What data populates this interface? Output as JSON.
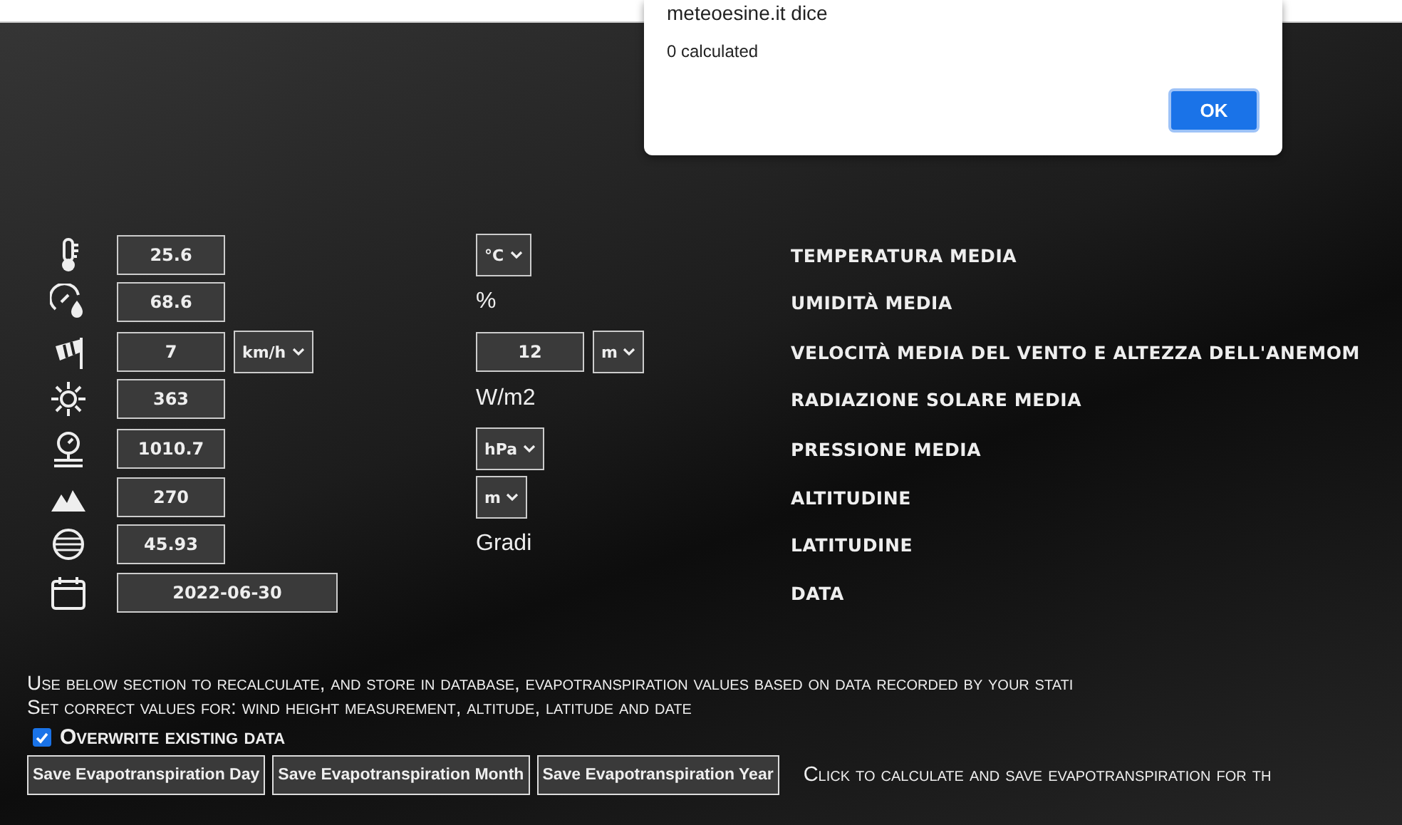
{
  "dialog": {
    "title": "meteoesine.it dice",
    "message": "0 calculated",
    "button": "OK"
  },
  "rows": [
    {
      "value": "25.6",
      "right": [
        {
          "kind": "select",
          "text": "°C"
        }
      ],
      "label": "TEMPERATURA MEDIA"
    },
    {
      "value": "68.6",
      "right": [
        {
          "kind": "text",
          "text": "%"
        }
      ],
      "label": "UMIDITÀ MEDIA"
    },
    {
      "value": "7",
      "value_unit": "km/h",
      "right": [
        {
          "kind": "field",
          "text": "12"
        },
        {
          "kind": "select",
          "text": "m"
        }
      ],
      "label": "VELOCITÀ MEDIA DEL VENTO E ALTEZZA DELL'ANEMOM"
    },
    {
      "value": "363",
      "right": [
        {
          "kind": "text",
          "text": "W/m2"
        }
      ],
      "label": "RADIAZIONE SOLARE MEDIA"
    },
    {
      "value": "1010.7",
      "right": [
        {
          "kind": "select",
          "text": "hPa"
        }
      ],
      "label": "PRESSIONE MEDIA"
    },
    {
      "value": "270",
      "right": [
        {
          "kind": "select",
          "text": "m"
        }
      ],
      "label": "ALTITUDINE"
    },
    {
      "value": "45.93",
      "right": [
        {
          "kind": "text",
          "text": "Gradi"
        }
      ],
      "label": "LATITUDINE"
    },
    {
      "value": "2022-06-30",
      "right": [],
      "label": "DATA"
    }
  ],
  "notes": [
    "Use below section to recalculate, and store in database, evapotranspiration values based on data recorded by your stati",
    "Set correct values for: wind height measurement, altitude, latitude and date"
  ],
  "overwrite": {
    "label": "Overwrite existing data",
    "checked": true
  },
  "buttons": [
    "Save Evapotranspiration Day",
    "Save Evapotranspiration Month",
    "Save Evapotranspiration Year"
  ],
  "hint": "Click to calculate and save evapotranspiration for th"
}
